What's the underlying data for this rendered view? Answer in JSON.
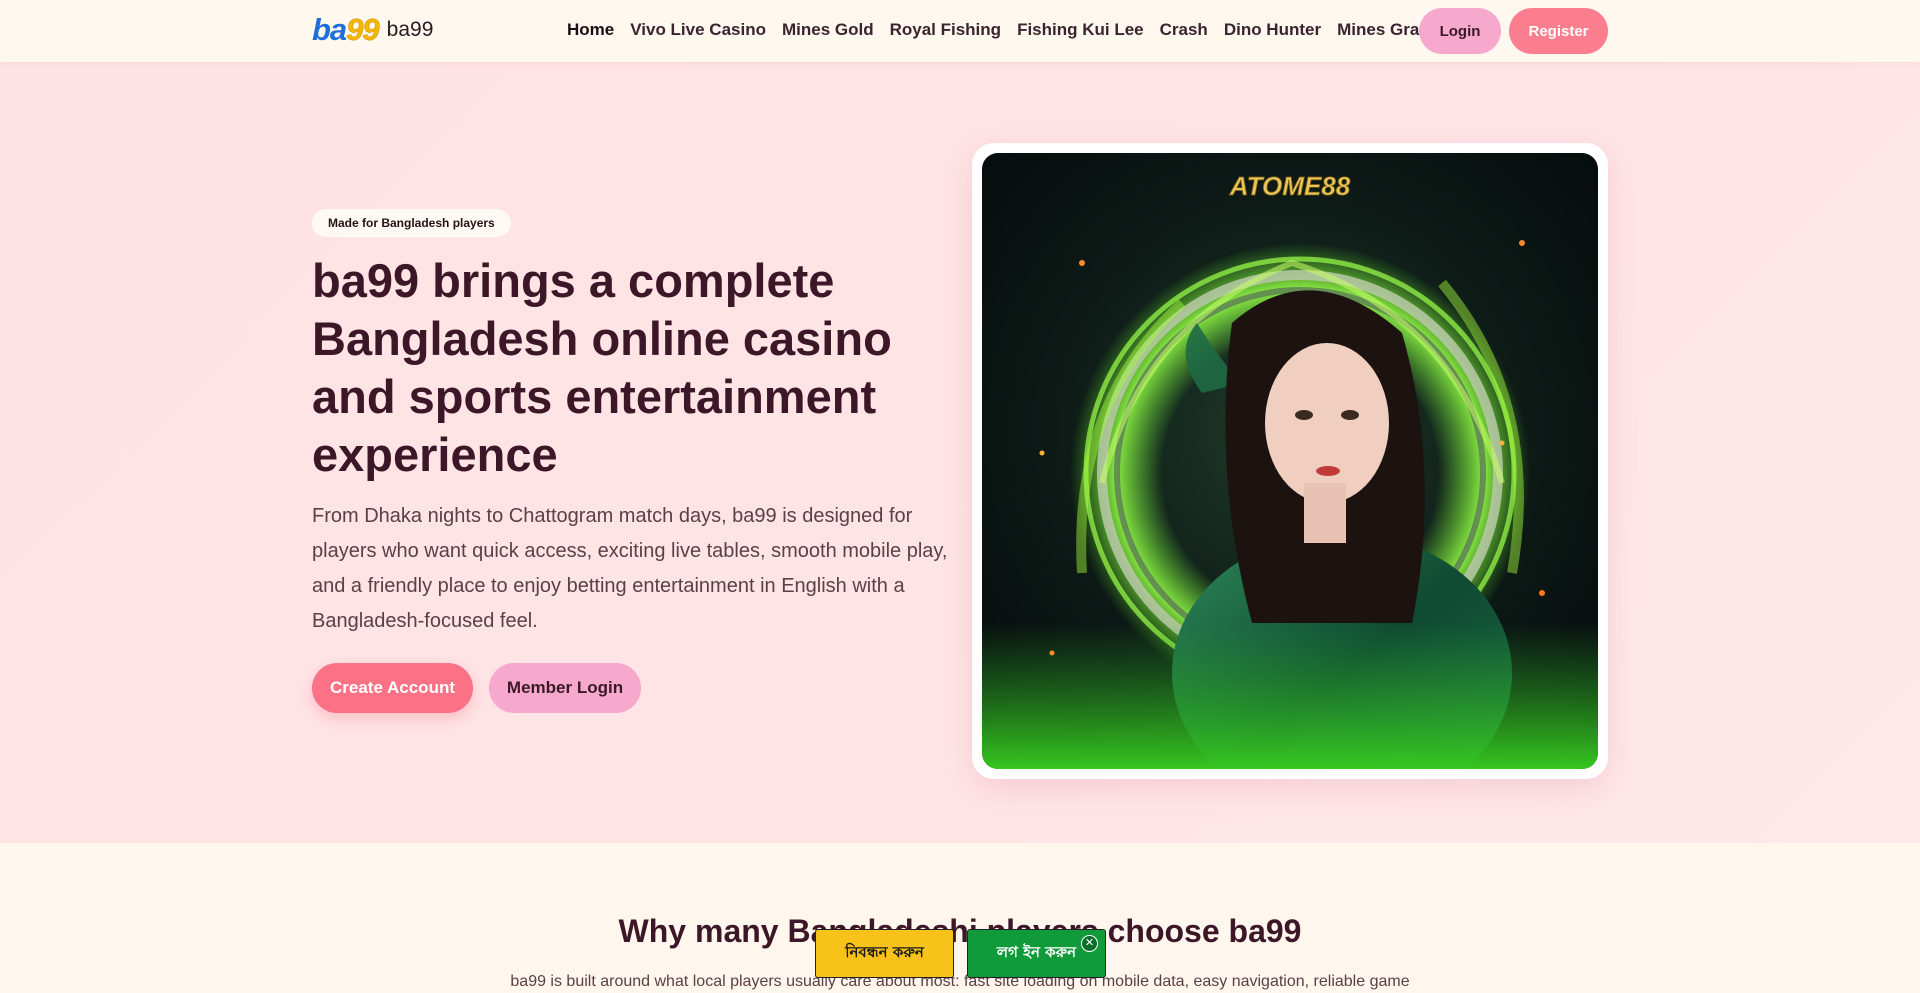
{
  "brand": {
    "logo_prefix": "ba",
    "logo_suffix": "99",
    "name": "ba99"
  },
  "nav": {
    "items": [
      {
        "label": "Home"
      },
      {
        "label": "Vivo Live Casino"
      },
      {
        "label": "Mines Gold"
      },
      {
        "label": "Royal Fishing"
      },
      {
        "label": "Fishing Kui Lee"
      },
      {
        "label": "Crash"
      },
      {
        "label": "Dino Hunter"
      },
      {
        "label": "Mines Grand"
      }
    ],
    "login_label": "Login",
    "register_label": "Register"
  },
  "hero": {
    "badge": "Made for Bangladesh players",
    "title": "ba99 brings a complete Bangladesh online casino and sports entertainment experience",
    "text": "From Dhaka nights to Chattogram match days, ba99 is designed for players who want quick access, exciting live tables, smooth mobile play, and a friendly place to enjoy betting entertainment in English with a Bangladesh-focused feel.",
    "create_label": "Create Account",
    "member_label": "Member Login",
    "image_brand": "ATOME88"
  },
  "section": {
    "title": "Why many Bangladeshi players choose ba99",
    "text": "ba99 is built around what local players usually care about most: fast site loading on mobile data, easy navigation, reliable game"
  },
  "floating": {
    "register_label": "নিবন্ধন করুন",
    "login_label": "লগ ইন করুন",
    "close_glyph": "✕"
  },
  "colors": {
    "accent_pink": "#fb7286",
    "soft_pink": "#f6a8cd",
    "title": "#3c1727",
    "float_yellow": "#f7c21a",
    "float_green": "#109a3a"
  }
}
